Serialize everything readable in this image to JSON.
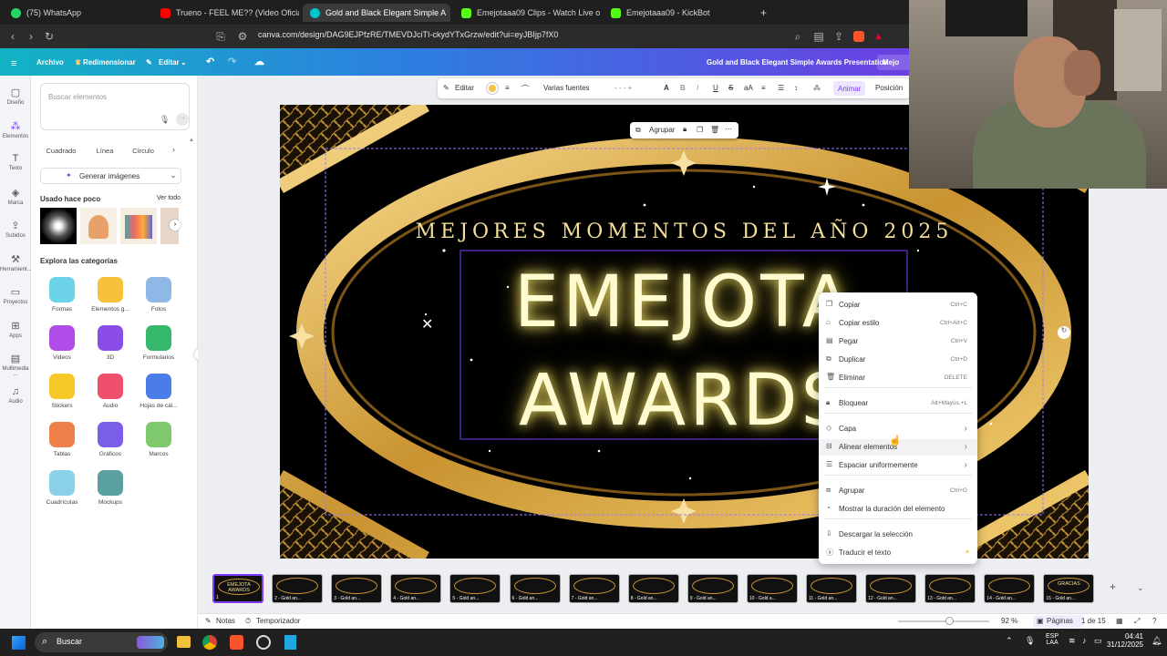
{
  "browser": {
    "tabs": [
      {
        "label": "(75) WhatsApp",
        "color": "#25d366"
      },
      {
        "label": "Trueno - FEEL ME?? (Video Oficial) - Y",
        "color": "#ff0000"
      },
      {
        "label": "Gold and Black Elegant Simple A",
        "color": "#00c4cc"
      },
      {
        "label": "Emejotaaa09 Clips - Watch Live o",
        "color": "#53fc18"
      },
      {
        "label": "Emejotaaa09 - KickBot",
        "color": "#53fc18"
      }
    ],
    "new_tab": "+",
    "close": "✕",
    "url": "canva.com/design/DAG9EJPfzRE/TMEVDJciTI-ckydYTxGrzw/edit?ui=eyJBIjp7fX0"
  },
  "canva_toolbar": {
    "archivo": "Archivo",
    "redimensionar": "Redimensionar",
    "editar": "Editar",
    "title": "Gold and Black Elegant Simple Awards Presentation",
    "mejora": "Mejo"
  },
  "rail": [
    {
      "label": "Diseño",
      "icon": "layout-icon"
    },
    {
      "label": "Elementos",
      "icon": "elements-icon"
    },
    {
      "label": "Texto",
      "icon": "text-icon"
    },
    {
      "label": "Marca",
      "icon": "brand-icon"
    },
    {
      "label": "Subidos",
      "icon": "upload-icon"
    },
    {
      "label": "Herramient...",
      "icon": "tools-icon"
    },
    {
      "label": "Proyectos",
      "icon": "folder-icon"
    },
    {
      "label": "Apps",
      "icon": "apps-icon"
    },
    {
      "label": "Multimedia ...",
      "icon": "multimedia-icon"
    },
    {
      "label": "Audio",
      "icon": "audio-icon"
    }
  ],
  "panel": {
    "search_placeholder": "Buscar elementos",
    "chips": [
      "Cuadrado",
      "Línea",
      "Círculo"
    ],
    "generate": "Generar imágenes",
    "recent_title": "Usado hace poco",
    "see_all": "Ver todo",
    "explore_title": "Explora las categorías",
    "categories": [
      {
        "label": "Formas",
        "color": "#6dd3e8"
      },
      {
        "label": "Elementos g...",
        "color": "#f6c23a"
      },
      {
        "label": "Fotos",
        "color": "#8fb8e6"
      },
      {
        "label": "Videos",
        "color": "#b04de8"
      },
      {
        "label": "3D",
        "color": "#8a4de8"
      },
      {
        "label": "Formularios",
        "color": "#35b86b"
      },
      {
        "label": "Stickers",
        "color": "#f7c928"
      },
      {
        "label": "Audio",
        "color": "#f0506e"
      },
      {
        "label": "Hojas de cál...",
        "color": "#4a7de8"
      },
      {
        "label": "Tablas",
        "color": "#f0804a"
      },
      {
        "label": "Gráficos",
        "color": "#7a5de8"
      },
      {
        "label": "Marcos",
        "color": "#7ec96b"
      },
      {
        "label": "Cuadrículas",
        "color": "#8ad0e8"
      },
      {
        "label": "Mockups",
        "color": "#5aa0a0"
      }
    ]
  },
  "ctx_toolbar": {
    "editar": "Editar",
    "fonts": "Varias fuentes",
    "size": "-  - -  +",
    "animar": "Animar",
    "posicion": "Posición"
  },
  "float_toolbar": {
    "agrupar": "Agrupar"
  },
  "slide": {
    "subtitle": "MEJORES MOMENTOS DEL AÑO 2025",
    "title_line1": "EMEJOTA",
    "title_line2": "AWARDS",
    "gold": "#e8b74a"
  },
  "context_menu": [
    {
      "label": "Copiar",
      "key": "Ctrl+C",
      "icon": "copy-icon"
    },
    {
      "label": "Copiar estilo",
      "key": "Ctrl+Alt+C",
      "icon": "paint-roller-icon"
    },
    {
      "label": "Pegar",
      "key": "Ctrl+V",
      "icon": "paste-icon"
    },
    {
      "label": "Duplicar",
      "key": "Ctrl+D",
      "icon": "duplicate-icon"
    },
    {
      "label": "Eliminar",
      "key": "DELETE",
      "icon": "trash-icon"
    },
    {
      "label": "Bloquear",
      "key": "Alt+Mayús.+L",
      "icon": "lock-icon"
    },
    {
      "label": "Capa",
      "key": "›",
      "icon": "layers-icon"
    },
    {
      "label": "Alinear elementos",
      "key": "›",
      "icon": "align-icon"
    },
    {
      "label": "Espaciar uniformemente",
      "key": "›",
      "icon": "spacing-icon"
    },
    {
      "label": "Agrupar",
      "key": "Ctrl+G",
      "icon": "group-icon"
    },
    {
      "label": "Mostrar la duración del elemento",
      "key": "",
      "icon": "timer-icon"
    },
    {
      "label": "Descargar la selección",
      "key": "",
      "icon": "download-icon"
    },
    {
      "label": "Traducir el texto",
      "key": "",
      "icon": "translate-icon"
    }
  ],
  "pages": [
    "1",
    "2 - Gold an...",
    "3 - Gold an...",
    "4 - Gold an...",
    "5 - Gold an...",
    "6 - Gold an...",
    "7 - Gold an...",
    "8 - Gold an...",
    "9 - Gold an...",
    "10 - Gold a...",
    "11 - Gold an...",
    "12 - Gold an...",
    "13 - Gold an...",
    "14 - Gold an...",
    "15 - Gold an..."
  ],
  "thumb_texts": {
    "first": "EMEJOTA AWARDS",
    "last": "GRACIAS"
  },
  "status": {
    "notas": "Notas",
    "temporizador": "Temporizador",
    "zoom": "92 %",
    "paginas": "Páginas",
    "page_of": "1 de 15"
  },
  "taskbar": {
    "search": "Buscar",
    "lang_top": "ESP",
    "lang_bottom": "LAA",
    "time": "04:41",
    "date": "31/12/2025"
  }
}
